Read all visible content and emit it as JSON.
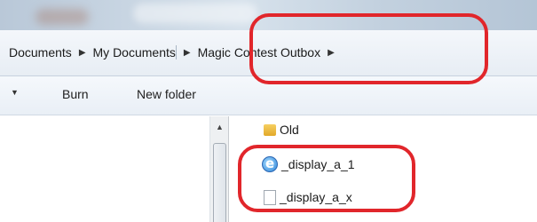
{
  "breadcrumb": {
    "items": [
      "Documents",
      "My Documents",
      "Magic Contest Outbox"
    ]
  },
  "toolbar": {
    "burn_label": "Burn",
    "new_folder_label": "New folder"
  },
  "files": [
    {
      "name": "Old",
      "icon": "folder-icon"
    },
    {
      "name": "_display_a_1",
      "icon": "ie-document-icon"
    },
    {
      "name": "_display_a_x",
      "icon": "document-icon"
    }
  ],
  "annotation_color": "#e1262b"
}
